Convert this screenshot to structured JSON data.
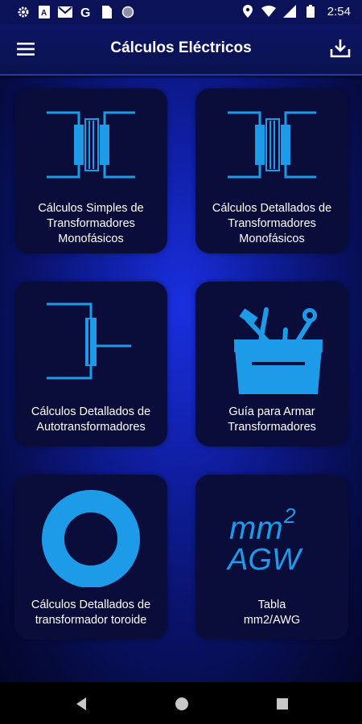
{
  "status_bar": {
    "time": "2:54",
    "icons": [
      "settings-icon",
      "news-icon",
      "mail-icon",
      "google-icon",
      "sim-icon",
      "circle-icon"
    ],
    "right_icons": [
      "location-icon",
      "wifi-icon",
      "signal-icon",
      "battery-icon"
    ]
  },
  "app_bar": {
    "title": "Cálculos Eléctricos",
    "menu_icon": "menu-icon",
    "action_icon": "download-icon"
  },
  "cards": [
    {
      "line1": "Cálculos Simples de",
      "line2": "Transformadores",
      "line3": "Monofásicos",
      "icon": "transformer-icon"
    },
    {
      "line1": "Cálculos Detallados de",
      "line2": "Transformadores",
      "line3": "Monofásicos",
      "icon": "transformer-icon"
    },
    {
      "line1": "Cálculos Detallados de",
      "line2": "Autotransformadores",
      "icon": "autotransformer-icon"
    },
    {
      "line1": "Guía para Armar",
      "line2": "Transformadores",
      "icon": "toolbox-icon"
    },
    {
      "line1": "Cálculos Detallados de",
      "line2": "transformador toroide",
      "icon": "toroid-icon"
    },
    {
      "line1": "Tabla",
      "line2": "mm2/AWG",
      "icon": "mm2-awg-icon",
      "icon_text1": "mm",
      "icon_sup": "2",
      "icon_text2": "AGW"
    }
  ],
  "colors": {
    "accent": "#1e9be8",
    "card": "#0a0d3a",
    "appbar": "#0b1257"
  },
  "nav_bar": {
    "icons": [
      "back-icon",
      "home-icon",
      "recents-icon"
    ]
  }
}
